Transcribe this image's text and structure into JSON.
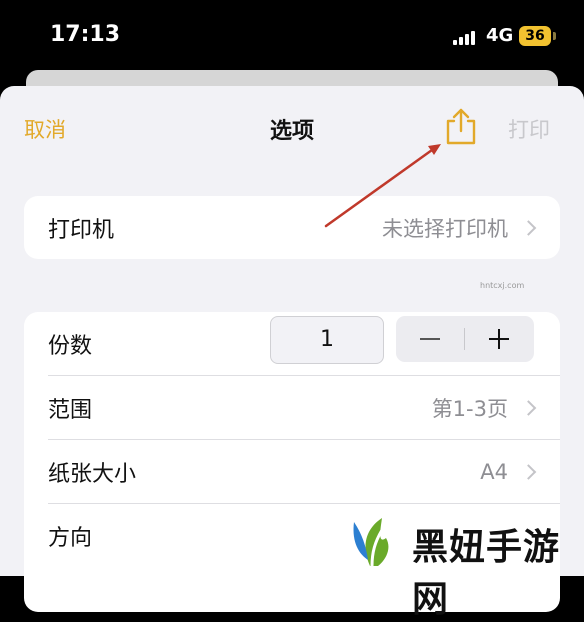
{
  "status_bar": {
    "time": "17:13",
    "network": "4G",
    "battery": "36"
  },
  "header": {
    "cancel_label": "取消",
    "title": "选项",
    "share_icon": "share-icon",
    "print_label": "打印"
  },
  "printer_row": {
    "label": "打印机",
    "value": "未选择打印机"
  },
  "options": {
    "copies": {
      "label": "份数",
      "value": "1"
    },
    "range": {
      "label": "范围",
      "value": "第1-3页"
    },
    "paper_size": {
      "label": "纸张大小",
      "value": "A4"
    },
    "orientation": {
      "label": "方向"
    }
  },
  "watermark": {
    "text": "黑妞手游网",
    "url": "hntcxj.com"
  },
  "colors": {
    "accent": "#e2a92a",
    "arrow": "#c0392b",
    "disabled": "#c8c8cc"
  }
}
